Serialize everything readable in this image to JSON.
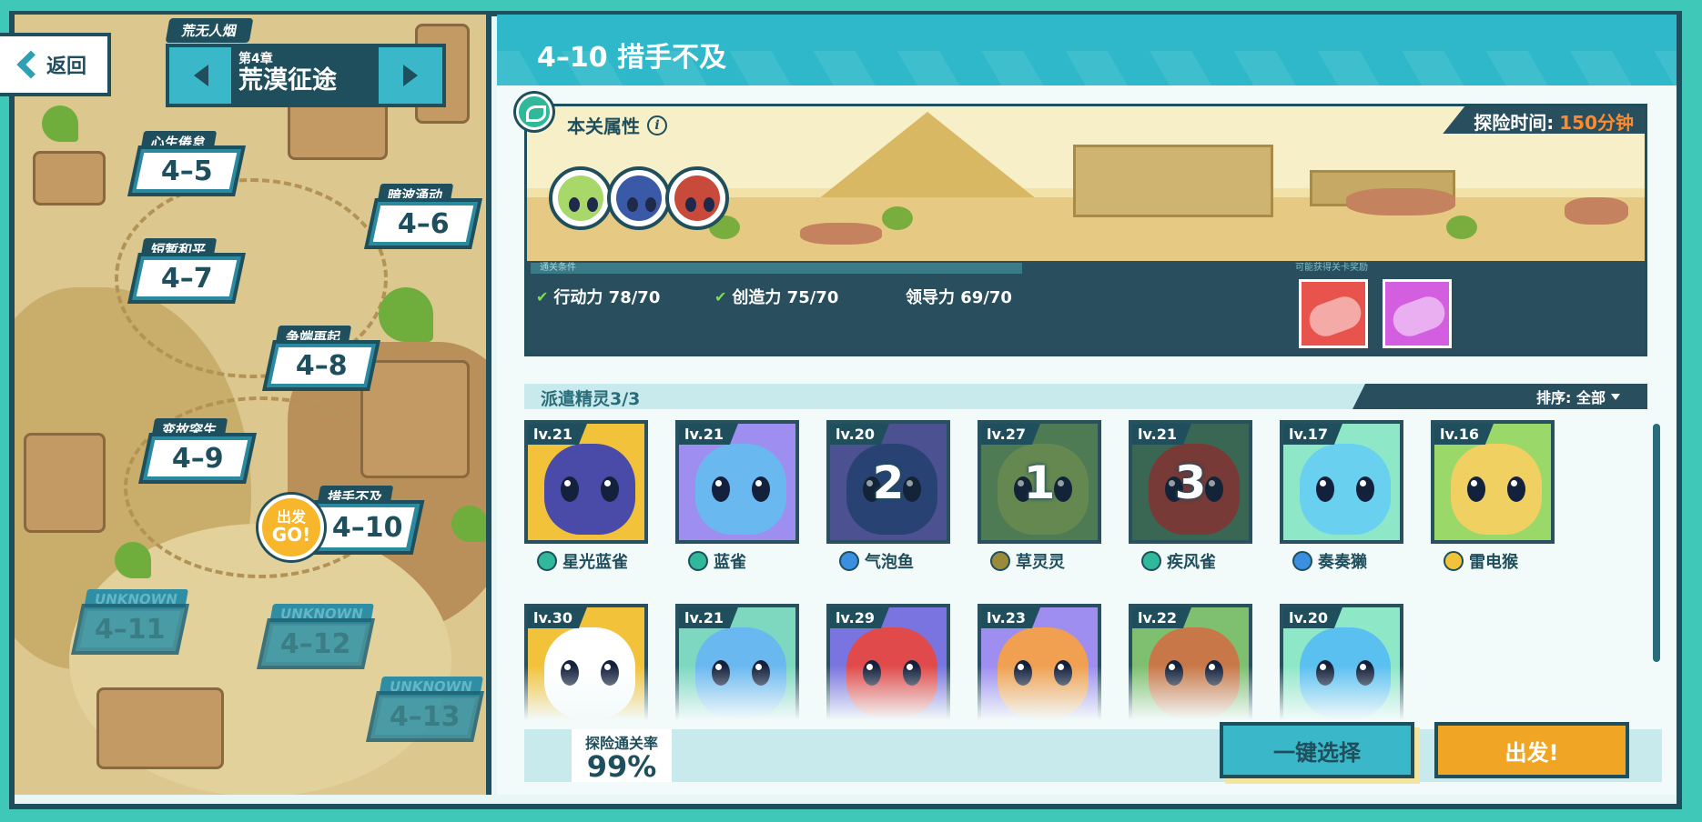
{
  "nav": {
    "back_label": "返回"
  },
  "chapter": {
    "prev_label": "荒无人烟",
    "number": "第4章",
    "name": "荒漠征途"
  },
  "levels": [
    {
      "name": "心生倦怠",
      "id": "4–5",
      "state": "cleared"
    },
    {
      "name": "暗波涌动",
      "id": "4–6",
      "state": "cleared"
    },
    {
      "name": "短暂和平",
      "id": "4–7",
      "state": "cleared"
    },
    {
      "name": "争端再起",
      "id": "4–8",
      "state": "cleared"
    },
    {
      "name": "变故突生",
      "id": "4–9",
      "state": "cleared"
    },
    {
      "name": "措手不及",
      "id": "4–10",
      "state": "current",
      "badge_top": "出发",
      "badge_bottom": "GO!"
    },
    {
      "name": "UNKNOWN",
      "id": "4–11",
      "state": "locked"
    },
    {
      "name": "UNKNOWN",
      "id": "4–12",
      "state": "locked"
    },
    {
      "name": "UNKNOWN",
      "id": "4–13",
      "state": "locked"
    }
  ],
  "stage": {
    "title": "4–10 措手不及",
    "attr_label": "本关属性",
    "time_label": "探险时间:",
    "time_value": "150分钟",
    "cond_header": "通关条件",
    "reward_header": "可能获得关卡奖励",
    "conditions": [
      {
        "label": "行动力 78/70",
        "met": true
      },
      {
        "label": "创造力 75/70",
        "met": true
      },
      {
        "label": "领导力 69/70",
        "met": false
      }
    ],
    "rewards": [
      {
        "icon": "motion-key-icon",
        "color": "#e8544d"
      },
      {
        "icon": "looks-key-icon",
        "color": "#d35ee0"
      }
    ]
  },
  "dispatch": {
    "label": "派遣精灵3/3",
    "sort_label": "排序: 全部"
  },
  "pets": [
    {
      "lv": "lv.21",
      "name": "星光蓝雀",
      "element": "grass",
      "color": "#4a4aa8",
      "bg": "#f2c23a",
      "order": ""
    },
    {
      "lv": "lv.21",
      "name": "蓝雀",
      "element": "grass",
      "color": "#6ab8f0",
      "bg": "#9d8ef0",
      "order": ""
    },
    {
      "lv": "lv.20",
      "name": "气泡鱼",
      "element": "water",
      "color": "#3a5aa8",
      "bg": "#7a74e0",
      "order": "2"
    },
    {
      "lv": "lv.27",
      "name": "草灵灵",
      "element": "earth",
      "color": "#a8d86a",
      "bg": "#7ec070",
      "order": "1"
    },
    {
      "lv": "lv.21",
      "name": "疾风雀",
      "element": "grass",
      "color": "#c84a3a",
      "bg": "#5a9a70",
      "order": "3"
    },
    {
      "lv": "lv.17",
      "name": "奏奏獭",
      "element": "water",
      "color": "#6ad0f0",
      "bg": "#8ee8c8",
      "order": ""
    },
    {
      "lv": "lv.16",
      "name": "雷电猴",
      "element": "electric",
      "color": "#f0d060",
      "bg": "#9ad86a",
      "order": ""
    },
    {
      "lv": "lv.30",
      "name": "",
      "element": "",
      "color": "#ffffff",
      "bg": "#f2c23a",
      "order": ""
    },
    {
      "lv": "lv.21",
      "name": "",
      "element": "",
      "color": "#6ab8f0",
      "bg": "#7ed8c0",
      "order": ""
    },
    {
      "lv": "lv.29",
      "name": "",
      "element": "",
      "color": "#e04a4a",
      "bg": "#7a74e0",
      "order": ""
    },
    {
      "lv": "lv.23",
      "name": "",
      "element": "",
      "color": "#f0a050",
      "bg": "#9d8ef0",
      "order": ""
    },
    {
      "lv": "lv.22",
      "name": "",
      "element": "",
      "color": "#c87848",
      "bg": "#7ec070",
      "order": ""
    },
    {
      "lv": "lv.20",
      "name": "",
      "element": "",
      "color": "#5ac0f0",
      "bg": "#8ee8c8",
      "order": ""
    }
  ],
  "footer": {
    "rate_label": "探险通关率",
    "rate_value": "99%",
    "auto_select_label": "一键选择",
    "go_label": "出发!"
  },
  "colors": {
    "frame": "#1f4e5c",
    "accent": "#2fb8c9",
    "go": "#f0a524",
    "time": "#ff8a2b"
  }
}
